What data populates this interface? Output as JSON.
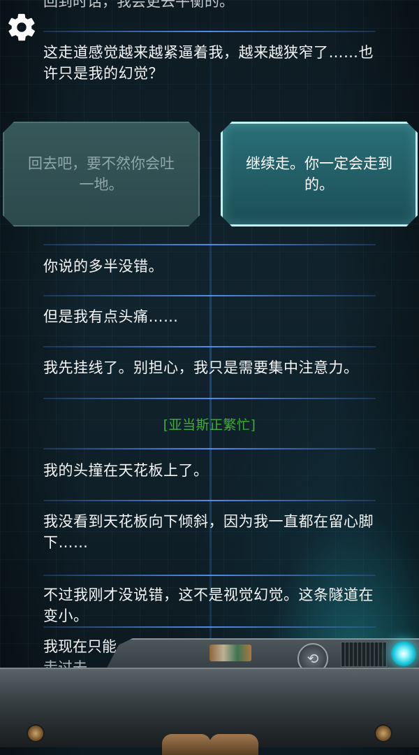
{
  "top_partial": "回到时话，我会更去平衡的。",
  "intro_message": "这走道感觉越来越紧逼着我，越来越狭窄了……也许只是我的幻觉？",
  "choices": [
    {
      "label": "回去吧，要不然你会吐一地。",
      "state": "dimmed"
    },
    {
      "label": "继续走。你一定会走到的。",
      "state": "selected"
    }
  ],
  "messages": [
    "你说的多半没错。",
    "但是我有点头痛……",
    "我先挂线了。别担心，我只是需要集中注意力。",
    "我的头撞在天花板上了。",
    "我没看到天花板向下倾斜，因为我一直都在留心脚下……",
    "不过我刚才没说错，这不是视觉幻觉。这条隧道在变小。"
  ],
  "system_status": "[亚当斯正繁忙]",
  "bottom_partial_line1": "我现在只能…费…要想…",
  "bottom_partial_line2": "走过去。",
  "icons": {
    "settings": "gear-icon",
    "device_knob": "dial-knob-icon",
    "status_light": "status-led-icon"
  },
  "colors": {
    "system_text": "#3fae3a",
    "separator": "#5a96ff",
    "selected_choice_border": "#bff3f3"
  }
}
